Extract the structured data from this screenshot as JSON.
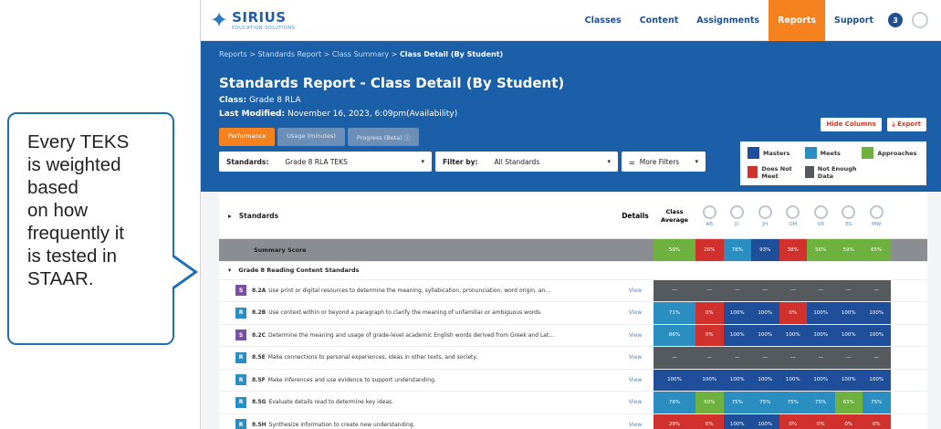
{
  "callout": {
    "text": "Every TEKS\nis weighted\nbased\non how\nfrequently it\nis tested in\nSTAAR."
  },
  "app": {
    "logo": {
      "name": "SIRIUS",
      "subtitle": "EDUCATION SOLUTIONS"
    },
    "nav": [
      {
        "label": "Classes",
        "active": false
      },
      {
        "label": "Content",
        "active": false
      },
      {
        "label": "Assignments",
        "active": false
      },
      {
        "label": "Reports",
        "active": true
      },
      {
        "label": "Support",
        "active": false
      }
    ],
    "notification_count": "3",
    "breadcrumb": {
      "path": "Reports > Standards Report > Class Summary > ",
      "current": "Class Detail (By Student)"
    },
    "title": "Standards Report - Class Detail (By Student)",
    "class_label": "Class:",
    "class_value": "Grade 8 RLA",
    "modified_label": "Last Modified:",
    "modified_value": "November 16, 2023, 6:09pm(Availability)",
    "tabs": [
      "Performance",
      "Usage (minutes)",
      "Progress (Beta) ⓘ"
    ],
    "filters": {
      "standards_label": "Standards:",
      "standards_value": "Grade 8 RLA TEKS",
      "filter_label": "Filter by:",
      "filter_value": "All Standards",
      "more_label": "More Filters"
    },
    "actions": {
      "hide": "Hide Columns",
      "export": "⤓ Export"
    },
    "legend": [
      {
        "label": "Masters",
        "color": "#1f4f9a"
      },
      {
        "label": "Meets",
        "color": "#2a8fc0"
      },
      {
        "label": "Approaches",
        "color": "#6eb13f"
      },
      {
        "label": "Does Not Meet",
        "color": "#d0312d"
      },
      {
        "label": "Not Enough Data",
        "color": "#555a5f"
      }
    ],
    "table": {
      "headers": {
        "standards": "Standards",
        "details": "Details",
        "average": "Class Average"
      },
      "students": [
        "AB",
        "JC",
        "JH",
        "OM",
        "VR",
        "ES",
        "MW"
      ],
      "summary": {
        "label": "Summary Score",
        "avg": "59%",
        "values": [
          "26%",
          "78%",
          "93%",
          "38%",
          "56%",
          "59%",
          "65%"
        ]
      },
      "group_label": "Grade 8 Reading Content Standards",
      "rows": [
        {
          "tag": "S",
          "tagColor": "#7b4fa3",
          "code": "8.2A",
          "text": "Use print or digital resources to determine the meaning, syllabication, pronunciation, word origin, an...",
          "view": "View",
          "avg": "—",
          "values": [
            "—",
            "—",
            "—",
            "—",
            "—",
            "—",
            "—"
          ]
        },
        {
          "tag": "R",
          "tagColor": "#2a8fc0",
          "code": "8.2B",
          "text": "Use context within or beyond a paragraph to clarify the meaning of unfamiliar or ambiguous words.",
          "view": "View",
          "avg": "71%",
          "values": [
            "0%",
            "100%",
            "100%",
            "0%",
            "100%",
            "100%",
            "100%"
          ]
        },
        {
          "tag": "S",
          "tagColor": "#7b4fa3",
          "code": "8.2C",
          "text": "Determine the meaning and usage of grade-level academic English words derived from Greek and Lat...",
          "view": "View",
          "avg": "86%",
          "values": [
            "0%",
            "100%",
            "100%",
            "100%",
            "100%",
            "100%",
            "100%"
          ]
        },
        {
          "tag": "R",
          "tagColor": "#2a8fc0",
          "code": "8.5E",
          "text": "Make connections to personal experiences, ideas in other texts, and society.",
          "view": "View",
          "avg": "—",
          "values": [
            "—",
            "—",
            "—",
            "—",
            "—",
            "—",
            "—"
          ]
        },
        {
          "tag": "R",
          "tagColor": "#2a8fc0",
          "code": "8.5F",
          "text": "Make inferences and use evidence to support understanding.",
          "view": "View",
          "avg": "100%",
          "values": [
            "100%",
            "100%",
            "100%",
            "100%",
            "100%",
            "100%",
            "100%"
          ]
        },
        {
          "tag": "R",
          "tagColor": "#2a8fc0",
          "code": "8.5G",
          "text": "Evaluate details read to determine key ideas.",
          "view": "View",
          "avg": "78%",
          "values": [
            "50%",
            "75%",
            "75%",
            "75%",
            "75%",
            "63%",
            "75%"
          ]
        },
        {
          "tag": "R",
          "tagColor": "#2a8fc0",
          "code": "8.5H",
          "text": "Synthesize information to create new understanding.",
          "view": "View",
          "avg": "29%",
          "values": [
            "0%",
            "100%",
            "100%",
            "0%",
            "0%",
            "0%",
            "0%"
          ]
        }
      ]
    }
  }
}
